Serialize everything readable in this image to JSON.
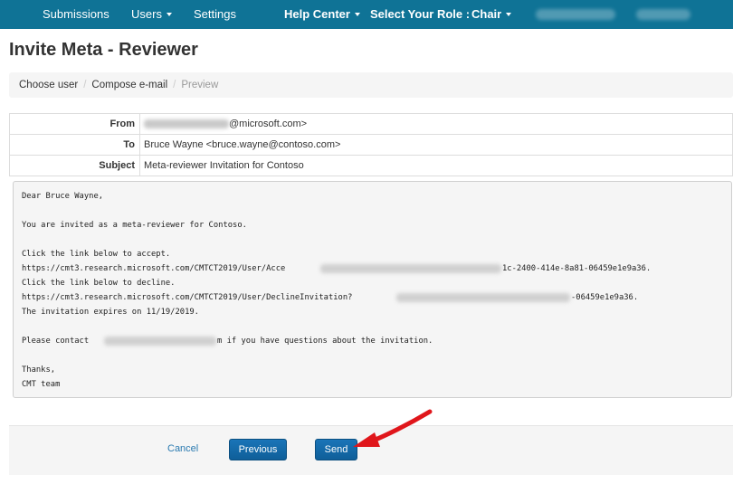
{
  "nav": {
    "submissions": "Submissions",
    "users": "Users",
    "settings": "Settings",
    "help_center": "Help Center",
    "role_label": "Select Your Role :",
    "role_value": "Chair"
  },
  "page": {
    "title": "Invite Meta - Reviewer"
  },
  "breadcrumb": {
    "items": [
      "Choose user",
      "Compose e-mail",
      "Preview"
    ]
  },
  "email": {
    "from_label": "From",
    "from_value_suffix": "@microsoft.com>",
    "to_label": "To",
    "to_value": "Bruce Wayne <bruce.wayne@contoso.com>",
    "subject_label": "Subject",
    "subject_value": "Meta-reviewer Invitation for Contoso",
    "body_lines": [
      "Dear Bruce Wayne,",
      "",
      "You are invited as a meta-reviewer for Contoso.",
      "",
      "Click the link below to accept.",
      "https://cmt3.research.microsoft.com/CMTCT2019/User/Acce",
      "Click the link below to decline.",
      "https://cmt3.research.microsoft.com/CMTCT2019/User/DeclineInvitation?",
      "The invitation expires on 11/19/2019.",
      "",
      "Please contact ",
      "",
      "Thanks,",
      "CMT team"
    ],
    "accept_link_tail": "1c-2400-414e-8a81-06459e1e9a36.",
    "decline_link_tail": "-06459e1e9a36.",
    "contact_tail": "m if you have questions about the invitation."
  },
  "footer": {
    "cancel_label": "Cancel",
    "previous_label": "Previous",
    "send_label": "Send"
  },
  "colors": {
    "navbar": "#0f7396",
    "primary_button": "#1a75b8",
    "annotation_arrow": "#e0161b"
  }
}
